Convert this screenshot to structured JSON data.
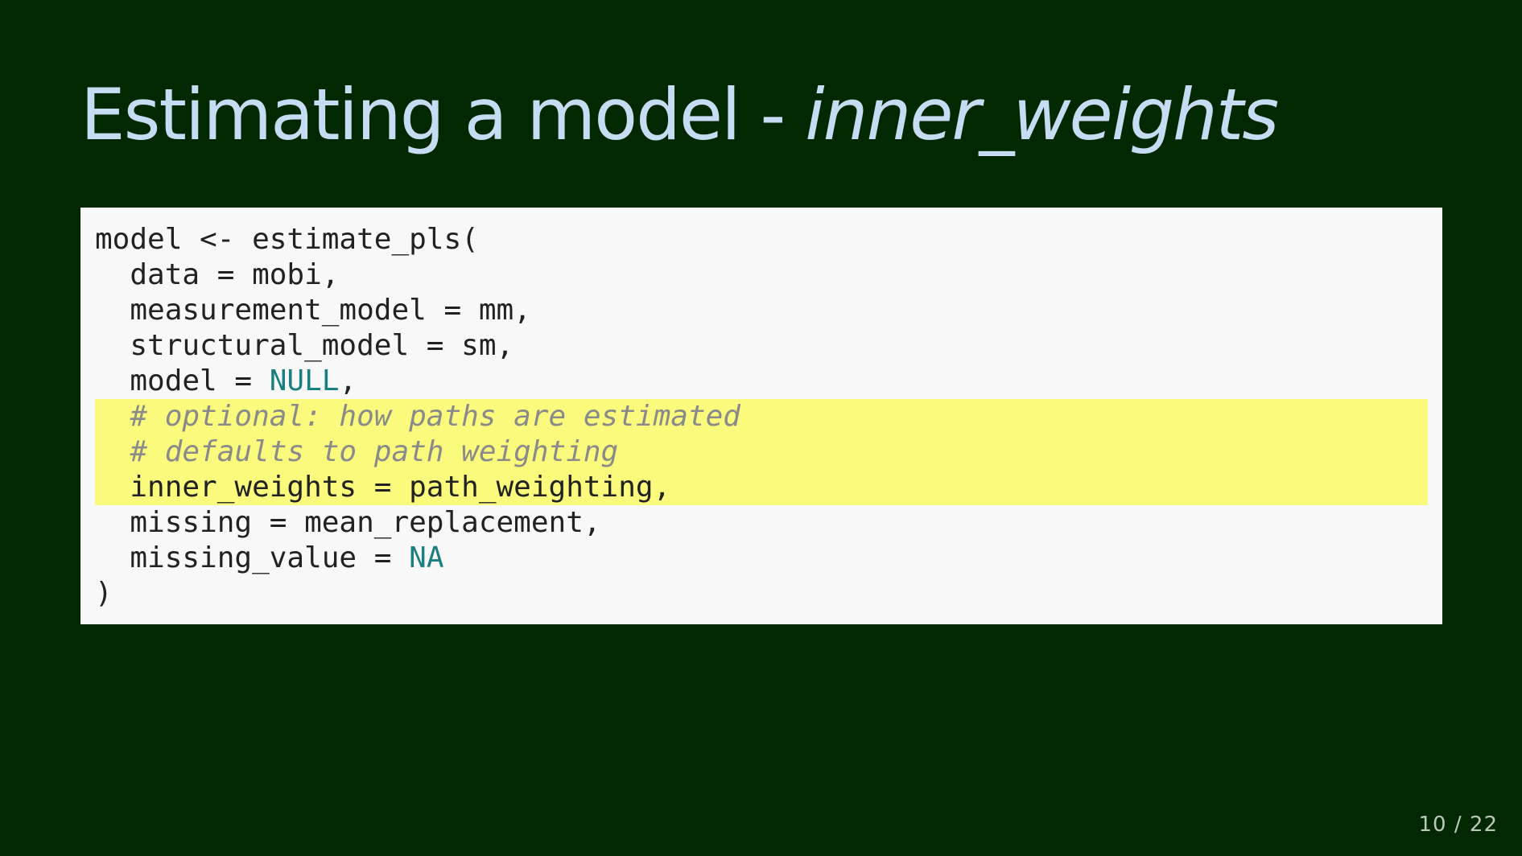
{
  "slide": {
    "title_plain": "Estimating a model - ",
    "title_emphasis": "inner_weights",
    "page_current": "10",
    "page_separator": " / ",
    "page_total": "22"
  },
  "code": {
    "lines": [
      {
        "text": "model <- estimate_pls("
      },
      {
        "text": "  data = mobi,"
      },
      {
        "text": "  measurement_model = mm,"
      },
      {
        "text": "  structural_model = sm,"
      },
      {
        "before": "  model = ",
        "const": "NULL",
        "after": ","
      },
      {
        "comment": "  # optional: how paths are estimated",
        "highlighted": true
      },
      {
        "comment": "  # defaults to path weighting",
        "highlighted": true
      },
      {
        "text": "  inner_weights = path_weighting,",
        "highlighted": true
      },
      {
        "text": "  missing = mean_replacement,"
      },
      {
        "before": "  missing_value = ",
        "const": "NA",
        "after": ""
      },
      {
        "text": ")"
      }
    ]
  },
  "colors": {
    "background": "#012800",
    "title": "#c6dcf2",
    "code_background": "#f8f8f8",
    "highlight": "#fafa7d",
    "constant": "#1b7f7f",
    "comment": "#8a8a8a"
  }
}
